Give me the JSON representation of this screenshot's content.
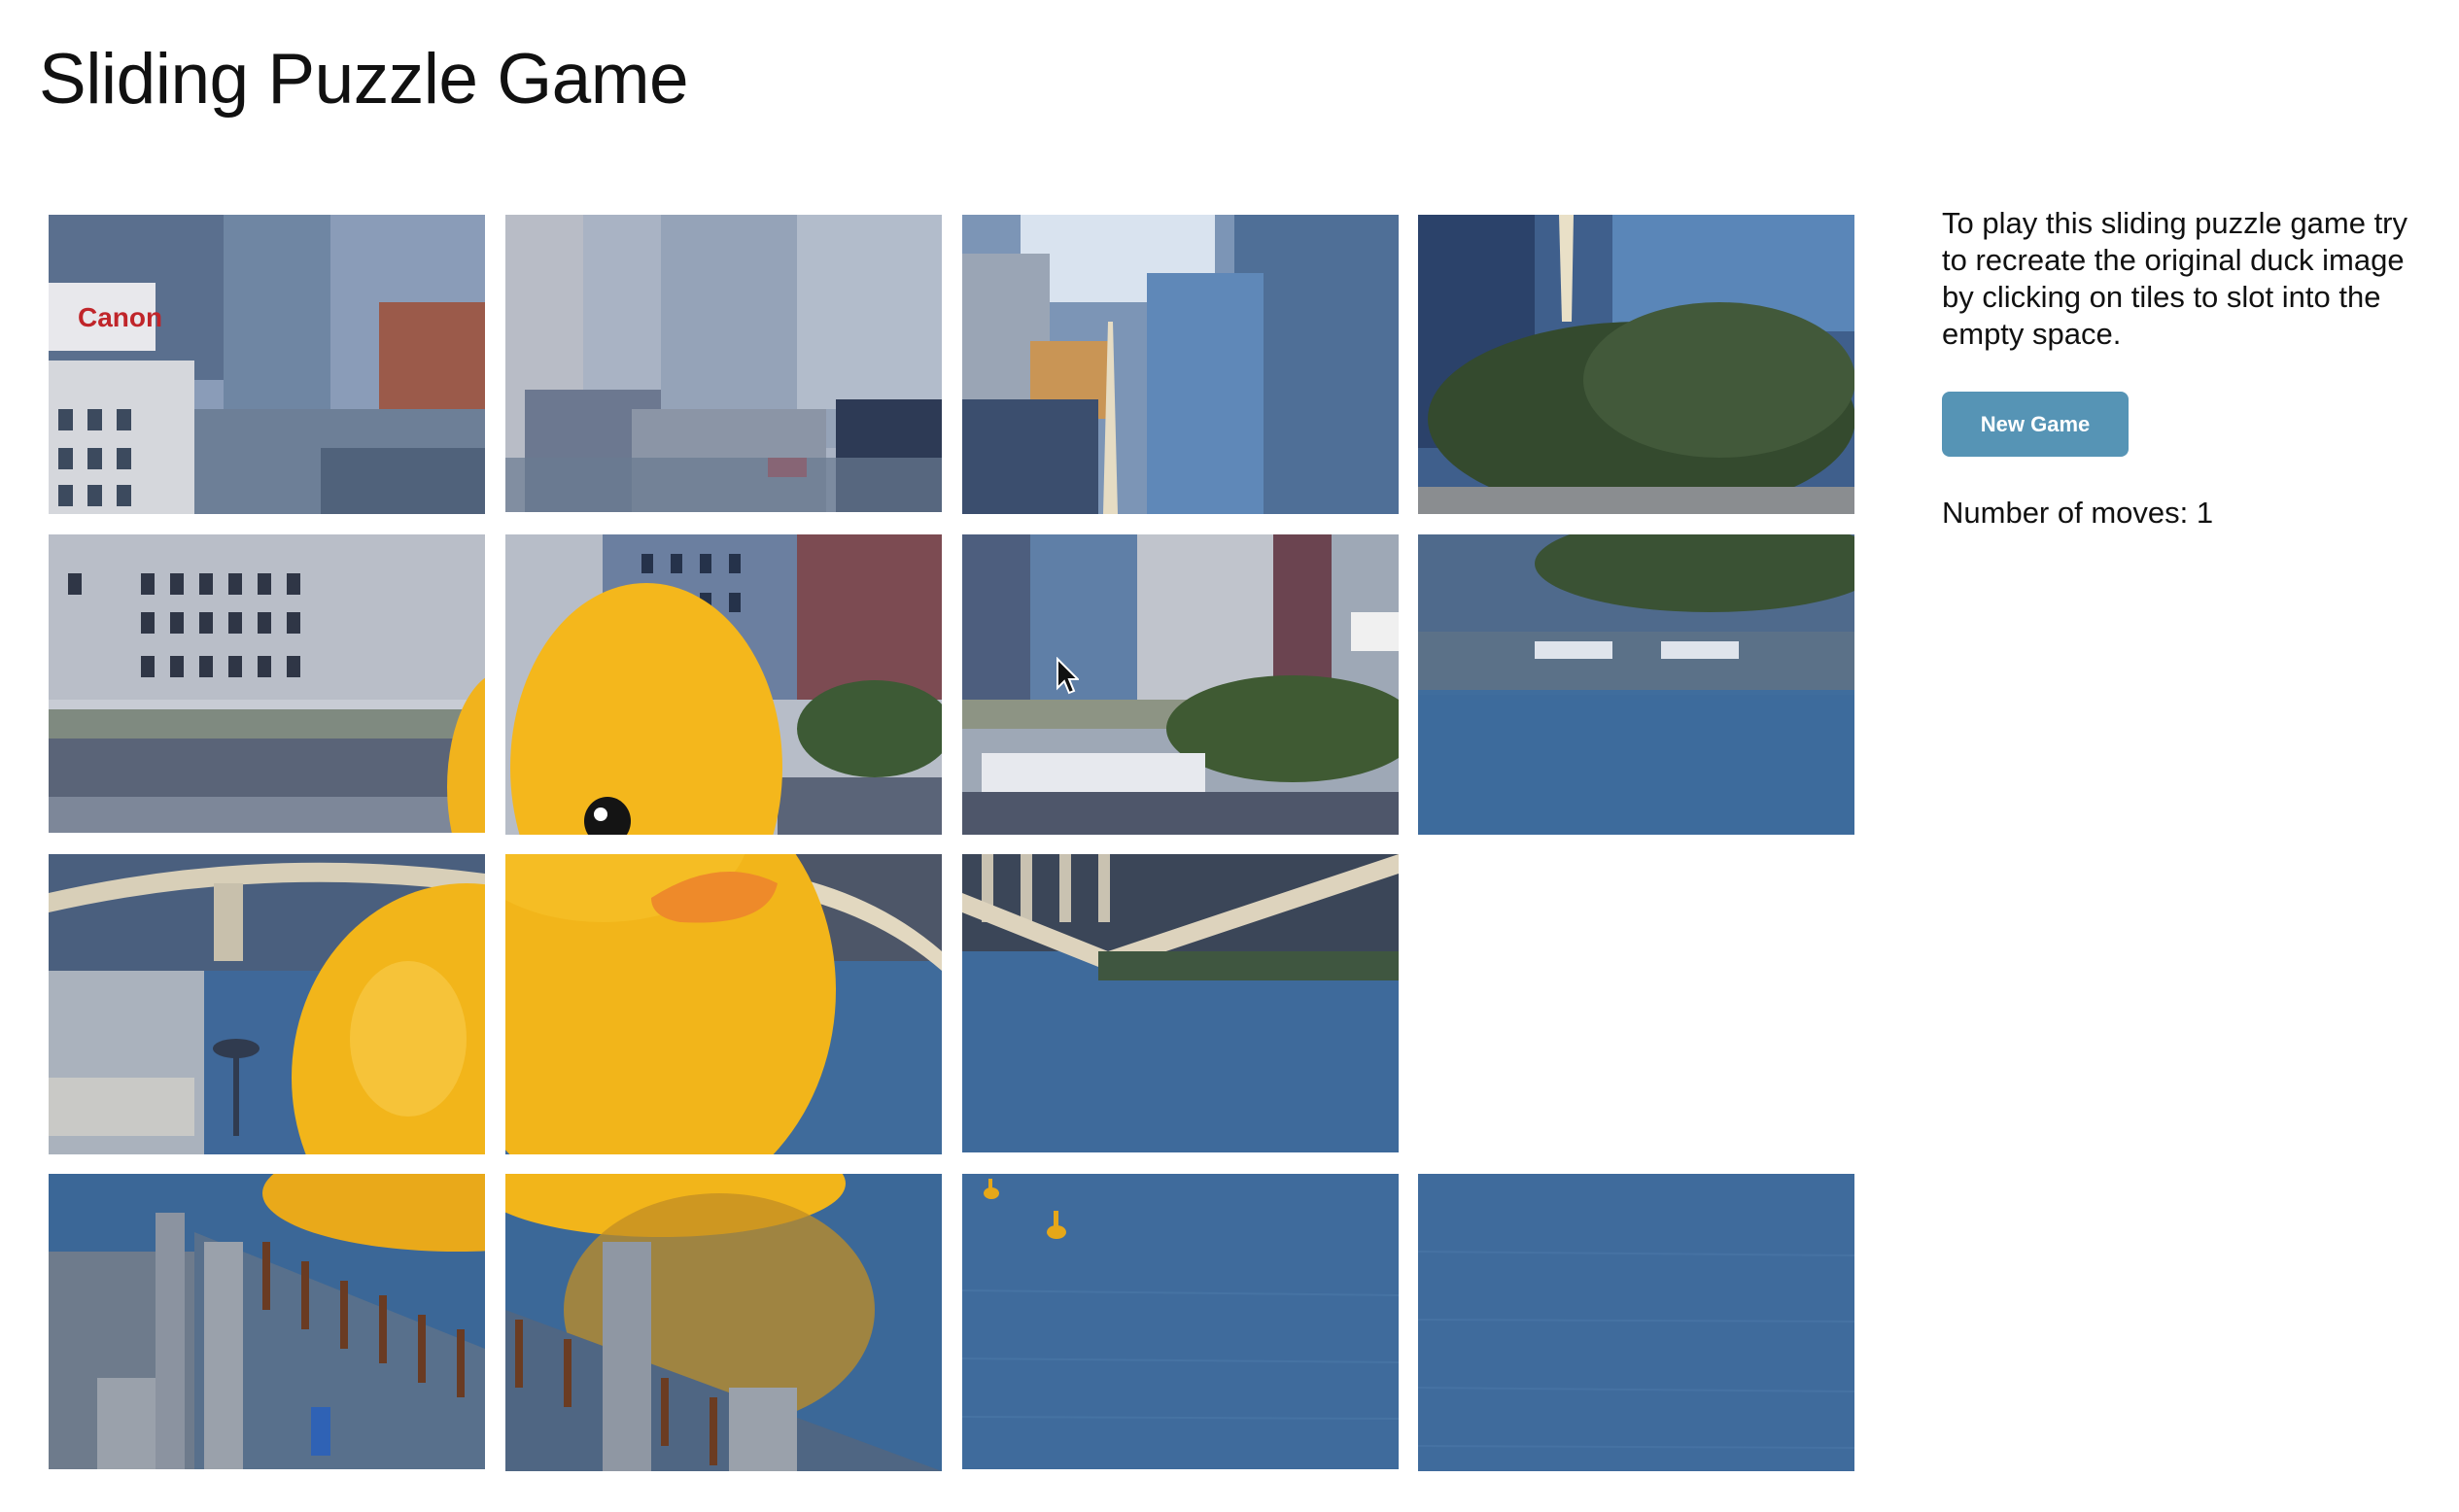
{
  "title": "Sliding Puzzle Game",
  "instructions": "To play this sliding puzzle game try to recreate the original duck image by clicking on tiles to slot into the empty space.",
  "new_game_label": "New Game",
  "moves": {
    "label": "Number of moves:",
    "count": 1
  },
  "colors": {
    "button": "#5694b5",
    "water": "#3f6b98",
    "duck": "#f2b51a",
    "sky_buildings": "#8797ab"
  },
  "board": {
    "rows": 4,
    "cols": 4,
    "empty_tile": {
      "row": 2,
      "col": 3
    },
    "tiles": [
      {
        "row": 0,
        "col": 0,
        "image_piece": "buildings-canon-sign"
      },
      {
        "row": 0,
        "col": 1,
        "image_piece": "buildings-skyscrapers"
      },
      {
        "row": 0,
        "col": 2,
        "image_piece": "buildings-tower-spire"
      },
      {
        "row": 0,
        "col": 3,
        "image_piece": "buildings-tree"
      },
      {
        "row": 1,
        "col": 0,
        "image_piece": "buildings-bridge"
      },
      {
        "row": 1,
        "col": 1,
        "image_piece": "duck-head"
      },
      {
        "row": 1,
        "col": 2,
        "image_piece": "buildings-bridge-trees"
      },
      {
        "row": 1,
        "col": 3,
        "image_piece": "riverbank-water"
      },
      {
        "row": 2,
        "col": 0,
        "image_piece": "bridge-duck-body-left"
      },
      {
        "row": 2,
        "col": 1,
        "image_piece": "duck-beak-body"
      },
      {
        "row": 2,
        "col": 2,
        "image_piece": "bridge-water"
      },
      {
        "row": 3,
        "col": 0,
        "image_piece": "pier-left"
      },
      {
        "row": 3,
        "col": 1,
        "image_piece": "pier-duck-reflection"
      },
      {
        "row": 3,
        "col": 2,
        "image_piece": "water-buoy"
      },
      {
        "row": 3,
        "col": 3,
        "image_piece": "water"
      }
    ]
  }
}
